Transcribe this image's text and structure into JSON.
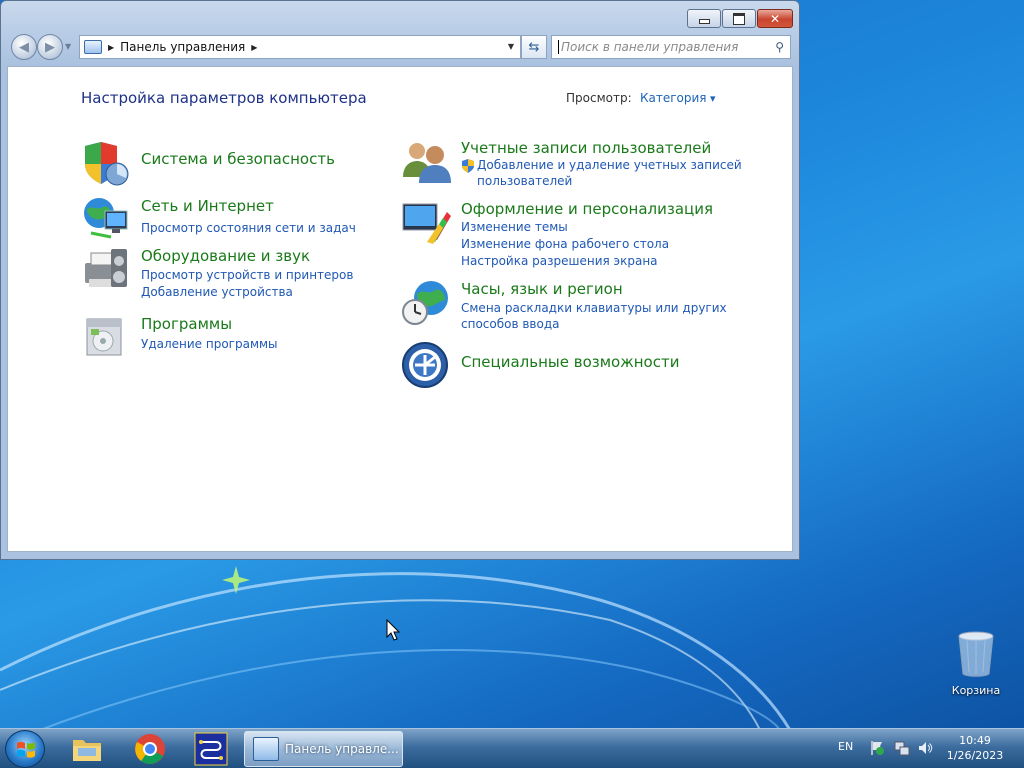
{
  "window": {
    "address": {
      "location": "Панель управления"
    },
    "search": {
      "placeholder": "Поиск в панели управления"
    },
    "content": {
      "title": "Настройка параметров компьютера",
      "view_label": "Просмотр:",
      "view_value": "Категория",
      "categories": [
        {
          "title": "Система и безопасность",
          "links": []
        },
        {
          "title": "Сеть и Интернет",
          "links": [
            "Просмотр состояния сети и задач"
          ]
        },
        {
          "title": "Оборудование и звук",
          "links": [
            "Просмотр устройств и принтеров",
            "Добавление устройства"
          ]
        },
        {
          "title": "Программы",
          "links": [
            "Удаление программы"
          ]
        },
        {
          "title": "Учетные записи пользователей",
          "links": [
            "Добавление и удаление учетных записей",
            "пользователей"
          ]
        },
        {
          "title": "Оформление и персонализация",
          "links": [
            "Изменение темы",
            "Изменение фона рабочего стола",
            "Настройка разрешения экрана"
          ]
        },
        {
          "title": "Часы, язык и регион",
          "links": [
            "Смена раскладки клавиатуры или других",
            "способов ввода"
          ]
        },
        {
          "title": "Специальные возможности",
          "links": []
        }
      ]
    }
  },
  "desktop": {
    "recycle_bin_label": "Корзина"
  },
  "taskbar": {
    "active_task": "Панель управле...",
    "language": "EN",
    "time": "10:49",
    "date": "1/26/2023"
  }
}
